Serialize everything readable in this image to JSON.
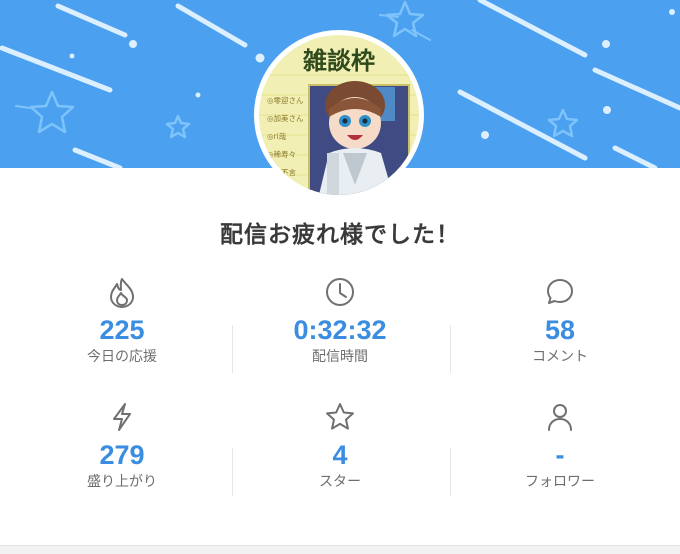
{
  "page": {
    "title": "配信お疲れ様でした！"
  },
  "colors": {
    "banner": "#4ba0f0",
    "value": "#3a8de0",
    "label": "#6e6e6e",
    "title": "#3a3a3a"
  },
  "avatar": {
    "heading": "雑談枠",
    "lines": [
      "◎零迎さん",
      "◎加美さん",
      "◎ri哉",
      "◎稀寿々",
      "◎し不言"
    ]
  },
  "stats": [
    {
      "icon": "fire-icon",
      "value": "225",
      "label": "今日の応援"
    },
    {
      "icon": "clock-icon",
      "value": "0:32:32",
      "label": "配信時間"
    },
    {
      "icon": "comment-icon",
      "value": "58",
      "label": "コメント"
    },
    {
      "icon": "lightning-icon",
      "value": "279",
      "label": "盛り上がり"
    },
    {
      "icon": "star-icon",
      "value": "4",
      "label": "スター"
    },
    {
      "icon": "person-icon",
      "value": "-",
      "label": "フォロワー"
    }
  ]
}
